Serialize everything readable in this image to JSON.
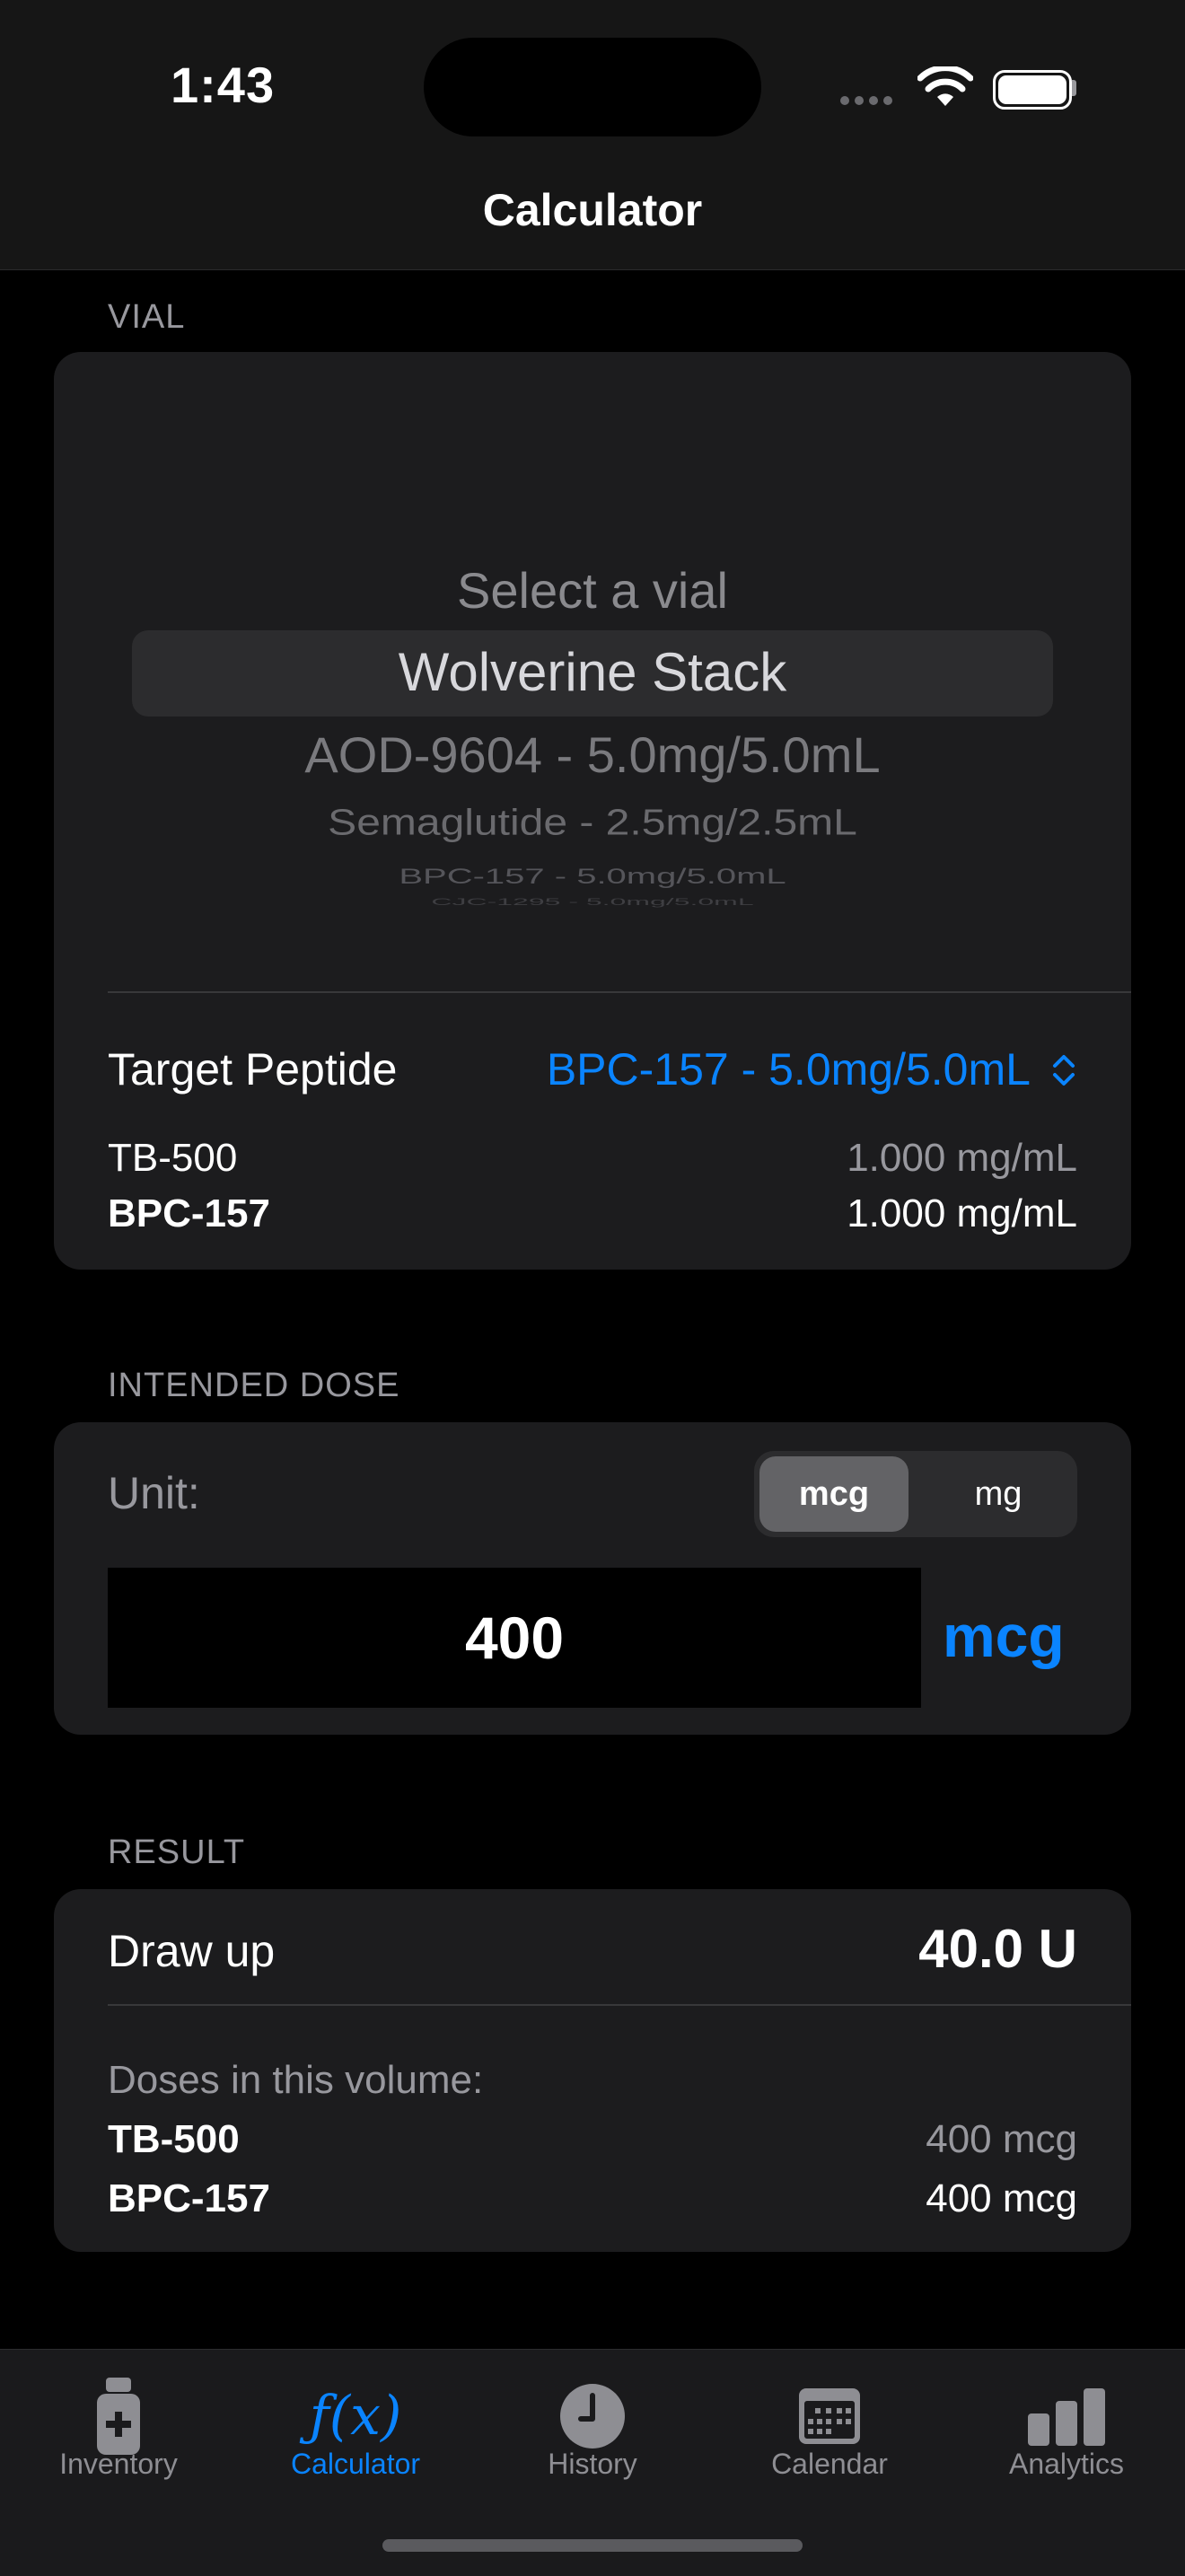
{
  "status_bar": {
    "time": "1:43"
  },
  "nav": {
    "title": "Calculator"
  },
  "vial": {
    "section_label": "VIAL",
    "picker_options": [
      "Select a vial",
      "Wolverine Stack",
      "AOD-9604 - 5.0mg/5.0mL",
      "Semaglutide - 2.5mg/2.5mL",
      "BPC-157 - 5.0mg/5.0mL",
      "CJC-1295 - 5.0mg/5.0mL"
    ],
    "selected": "Wolverine Stack",
    "target_label": "Target Peptide",
    "target_value": "BPC-157 - 5.0mg/5.0mL",
    "concentrations": [
      {
        "name": "TB-500",
        "value": "1.000 mg/mL"
      },
      {
        "name": "BPC-157",
        "value": "1.000 mg/mL"
      }
    ]
  },
  "dose": {
    "section_label": "INTENDED DOSE",
    "unit_label": "Unit:",
    "unit_options": [
      "mcg",
      "mg"
    ],
    "selected_unit": "mcg",
    "value": "400",
    "unit_suffix": "mcg"
  },
  "result": {
    "section_label": "RESULT",
    "draw_label": "Draw up",
    "draw_value": "40.0 U",
    "doses_label": "Doses in this volume:",
    "doses": [
      {
        "name": "TB-500",
        "value": "400 mcg"
      },
      {
        "name": "BPC-157",
        "value": "400 mcg"
      }
    ]
  },
  "tabs": [
    {
      "label": "Inventory",
      "icon": "vial-icon"
    },
    {
      "label": "Calculator",
      "icon": "function-icon",
      "active": true
    },
    {
      "label": "History",
      "icon": "clock-icon"
    },
    {
      "label": "Calendar",
      "icon": "calendar-icon"
    },
    {
      "label": "Analytics",
      "icon": "bar-chart-icon"
    }
  ],
  "colors": {
    "accent": "#0a84ff",
    "background": "#000000",
    "card": "#1c1c1e"
  }
}
